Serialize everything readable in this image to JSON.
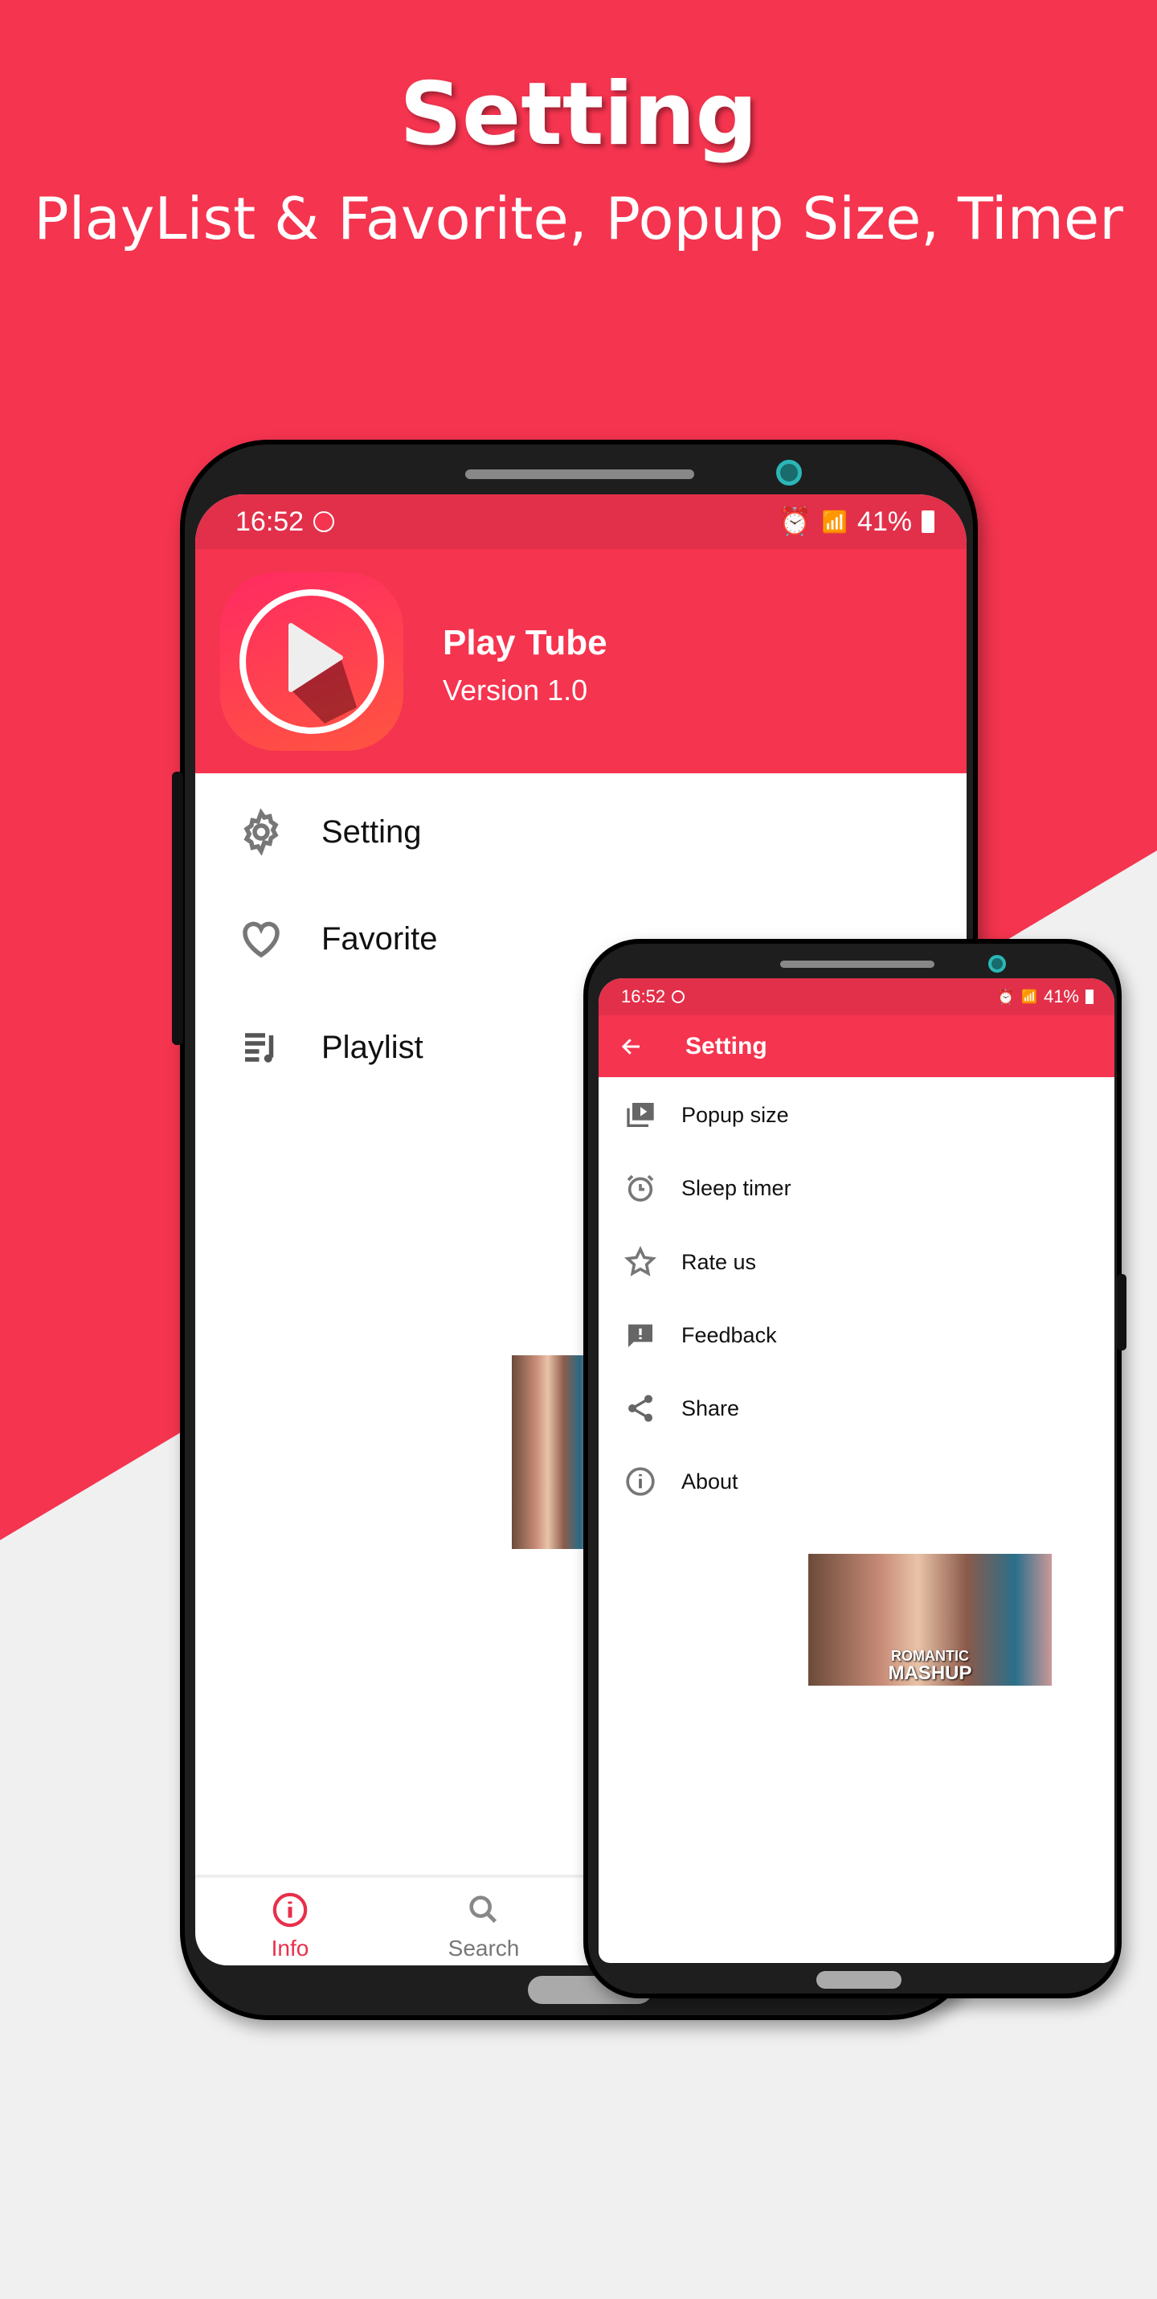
{
  "hero": {
    "title": "Setting",
    "subtitle": "PlayList & Favorite, Popup Size, Timer"
  },
  "colors": {
    "accent": "#f5344f",
    "background": "#f0f0f0"
  },
  "main_phone": {
    "status": {
      "time": "16:52",
      "battery": "41%"
    },
    "app": {
      "name": "Play Tube",
      "version": "Version 1.0"
    },
    "menu": [
      {
        "label": "Setting",
        "icon": "gear-icon"
      },
      {
        "label": "Favorite",
        "icon": "heart-icon"
      },
      {
        "label": "Playlist",
        "icon": "playlist-icon"
      }
    ],
    "bottom_nav": [
      {
        "label": "Info",
        "icon": "info-icon",
        "active": true
      },
      {
        "label": "Search",
        "icon": "search-icon",
        "active": false
      }
    ]
  },
  "second_phone": {
    "status": {
      "time": "16:52",
      "battery": "41%"
    },
    "toolbar": {
      "title": "Setting"
    },
    "items": [
      {
        "label": "Popup size",
        "icon": "popup-icon"
      },
      {
        "label": "Sleep timer",
        "icon": "alarm-icon"
      },
      {
        "label": "Rate us",
        "icon": "star-icon"
      },
      {
        "label": "Feedback",
        "icon": "feedback-icon"
      },
      {
        "label": "Share",
        "icon": "share-icon"
      },
      {
        "label": "About",
        "icon": "info-icon"
      }
    ],
    "thumbnail": {
      "line1": "ROMANTIC",
      "line2": "MASHUP"
    }
  }
}
